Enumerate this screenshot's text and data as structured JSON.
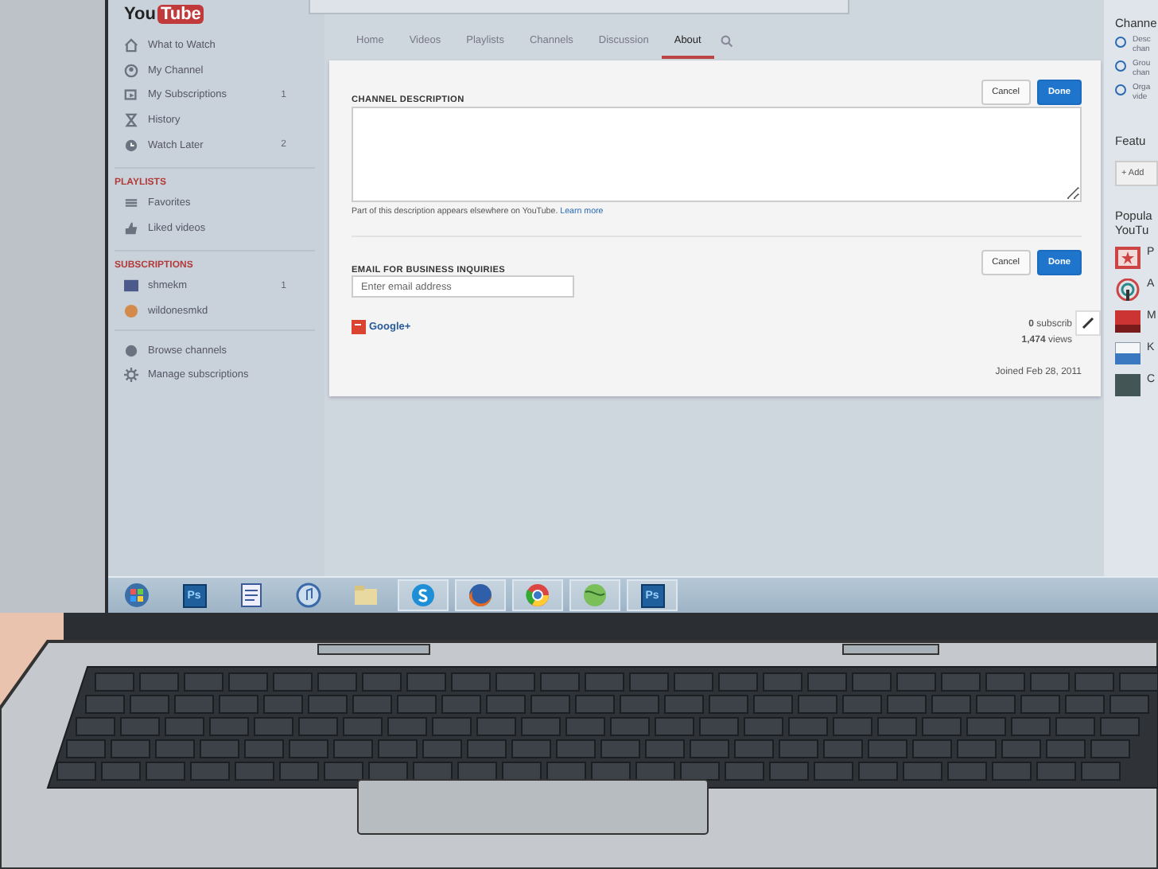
{
  "header": {
    "logo_left": "You",
    "logo_right": "Tube"
  },
  "sidebar": {
    "items": [
      {
        "kind": "home",
        "label": "What to Watch"
      },
      {
        "kind": "person",
        "label": "My Channel"
      },
      {
        "kind": "subs",
        "label": "My Subscriptions",
        "count": "1"
      },
      {
        "kind": "hourglass",
        "label": "History"
      },
      {
        "kind": "clock",
        "label": "Watch Later",
        "count": "2"
      }
    ],
    "sections": [
      {
        "heading": "PLAYLISTS",
        "items": [
          {
            "kind": "list",
            "label": "Favorites"
          },
          {
            "kind": "thumb",
            "label": "Liked videos"
          }
        ]
      },
      {
        "heading": "SUBSCRIPTIONS",
        "items": [
          {
            "kind": "thumbnail",
            "label": "shmekm",
            "count": "1"
          },
          {
            "kind": "avatar",
            "label": "wildonesmkd"
          }
        ]
      }
    ],
    "footer": [
      {
        "kind": "plus-circle",
        "label": "Browse channels"
      },
      {
        "kind": "gear",
        "label": "Manage subscriptions"
      }
    ]
  },
  "tabs": [
    {
      "label": "Home",
      "selected": false
    },
    {
      "label": "Videos",
      "selected": false
    },
    {
      "label": "Playlists",
      "selected": false
    },
    {
      "label": "Channels",
      "selected": false
    },
    {
      "label": "Discussion",
      "selected": false
    },
    {
      "label": "About",
      "selected": true
    }
  ],
  "about": {
    "description": {
      "label": "CHANNEL DESCRIPTION",
      "hint": "Part of this description appears elsewhere on YouTube.",
      "link": "Learn more",
      "buttons": [
        "Cancel",
        "Done"
      ]
    },
    "email": {
      "label": "EMAIL FOR BUSINESS INQUIRIES",
      "placeholder": "Enter email address",
      "buttons": [
        "Cancel",
        "Done"
      ]
    },
    "google_plus": "Google+",
    "stats": [
      {
        "value": "0",
        "unit": "subscrib"
      },
      {
        "value": "1,474",
        "unit": "views"
      }
    ],
    "joined": "Joined Feb 28, 2011"
  },
  "right_panel": {
    "title": "Channe",
    "tips": [
      [
        "Desc",
        "chan"
      ],
      [
        "Grou",
        "chan"
      ],
      [
        "Orga",
        "vide"
      ]
    ],
    "featured": "Featu",
    "add": "+ Add",
    "popular": [
      "Popula",
      "YouTu"
    ],
    "channels": [
      {
        "kind": "star",
        "label": "P"
      },
      {
        "kind": "antenna",
        "label": "A"
      },
      {
        "kind": "hot",
        "label": "M"
      },
      {
        "kind": "kbs",
        "label": "K"
      },
      {
        "kind": "flag",
        "label": "C"
      }
    ]
  },
  "taskbar": [
    {
      "kind": "start",
      "open": false
    },
    {
      "kind": "ps",
      "label": "Ps",
      "open": false
    },
    {
      "kind": "doc",
      "open": false
    },
    {
      "kind": "music",
      "open": false
    },
    {
      "kind": "folder",
      "open": false
    },
    {
      "kind": "skype",
      "open": true
    },
    {
      "kind": "firefox",
      "open": true
    },
    {
      "kind": "chrome",
      "open": true
    },
    {
      "kind": "globe",
      "open": true
    },
    {
      "kind": "ps",
      "label": "Ps",
      "open": true
    }
  ]
}
